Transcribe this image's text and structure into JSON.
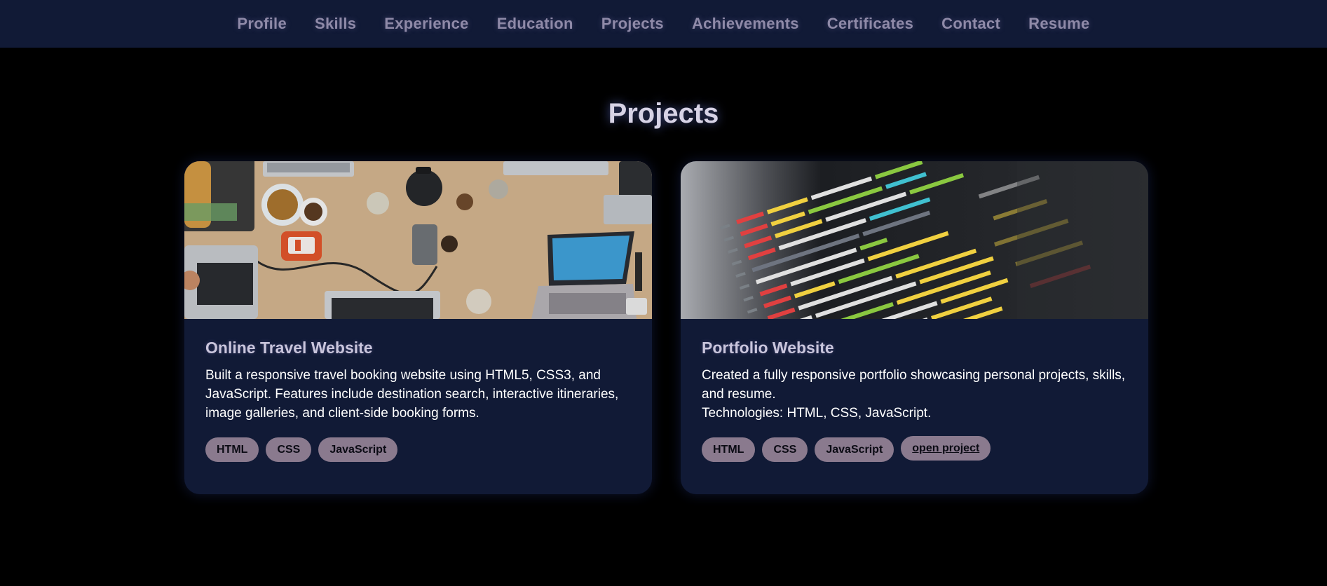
{
  "nav": {
    "items": [
      {
        "label": "Profile"
      },
      {
        "label": "Skills"
      },
      {
        "label": "Experience"
      },
      {
        "label": "Education"
      },
      {
        "label": "Projects"
      },
      {
        "label": "Achievements"
      },
      {
        "label": "Certificates"
      },
      {
        "label": "Contact"
      },
      {
        "label": "Resume"
      }
    ]
  },
  "section": {
    "title": "Projects"
  },
  "projects": [
    {
      "title": "Online Travel Website",
      "description": "Built a responsive travel booking website using HTML5, CSS3, and JavaScript. Features include destination search, interactive itineraries, image galleries, and client-side booking forms.",
      "tags": [
        "HTML",
        "CSS",
        "JavaScript"
      ],
      "image_icon": "laptops-on-desk-photo"
    },
    {
      "title": "Portfolio Website",
      "description": "Created a fully responsive portfolio showcasing personal projects, skills, and resume.",
      "tech_line": "Technologies: HTML, CSS, JavaScript.",
      "tags": [
        "HTML",
        "CSS",
        "JavaScript"
      ],
      "link_label": "open project",
      "image_icon": "code-screen-photo"
    }
  ],
  "colors": {
    "background": "#000000",
    "navbar": "#111a36",
    "nav_text": "#8f8aa8",
    "card": "#111a36",
    "tag": "#8a7a8e",
    "title_glow": "#7890ff"
  }
}
